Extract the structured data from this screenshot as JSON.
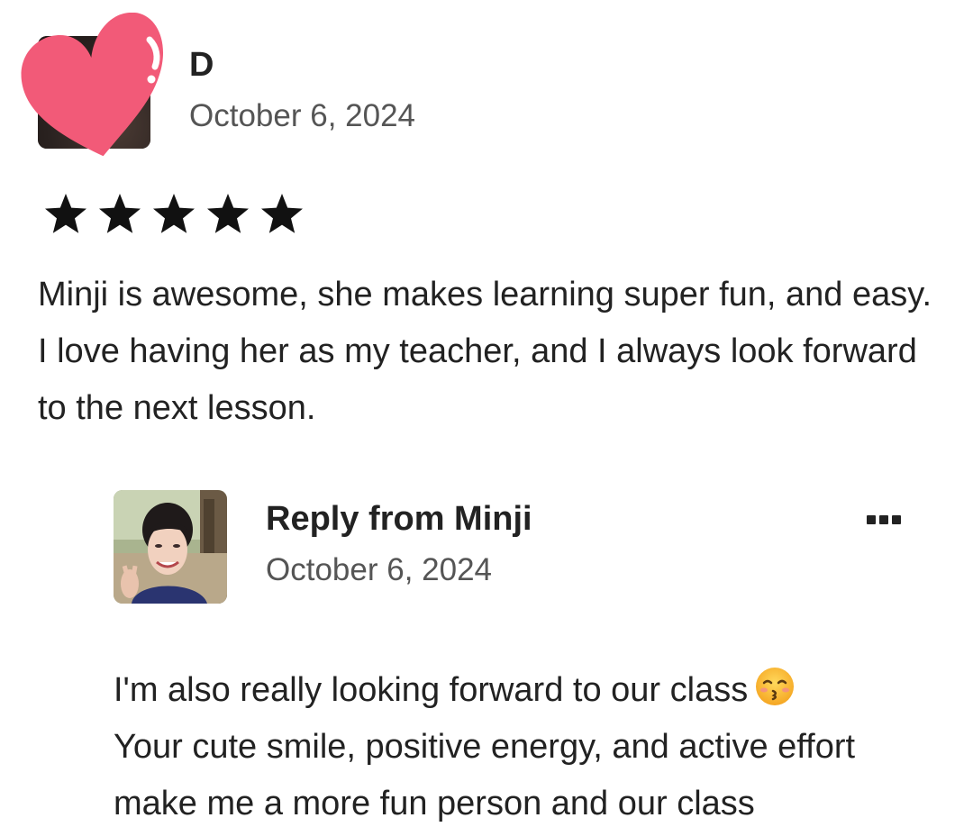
{
  "review": {
    "reviewer_name": "D",
    "date": "October 6, 2024",
    "rating": 5,
    "text": "Minji is awesome, she makes learning super fun, and easy. I love having her as my teacher, and I always look forward to the next lesson."
  },
  "reply": {
    "title": "Reply from Minji",
    "date": "October 6, 2024",
    "text_line1": "I'm also really looking forward to our class",
    "emoji": "kissing-face-with-closed-eyes",
    "text_rest": "Your cute smile, positive energy, and active effort make me a more fun person and our class"
  },
  "colors": {
    "heart": "#f25a78",
    "text_primary": "#222222",
    "text_secondary": "#555555"
  },
  "icons": {
    "star": "star-icon",
    "more": "more-options-icon",
    "heart": "heart-sticker-icon"
  }
}
